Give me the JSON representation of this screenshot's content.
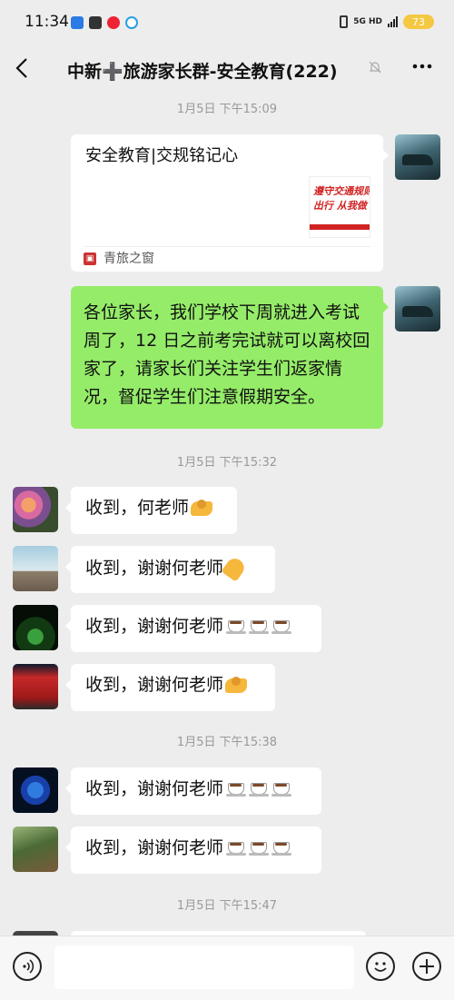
{
  "status_bar": {
    "time": "11:34",
    "network": "5G HD",
    "battery": "73",
    "colors": {
      "battery": "#f4c842"
    }
  },
  "nav": {
    "back_icon": "chevron-left-icon",
    "title": "中新➕旅游家长群-安全教育(222)",
    "mute_icon": "bell-off-icon",
    "more_icon": "more-dots-icon"
  },
  "timestamps": [
    "1月5日 下午15:09",
    "1月5日 下午15:32",
    "1月5日 下午15:38",
    "1月5日 下午15:47"
  ],
  "link_card": {
    "title": "安全教育|交规铭记心",
    "source": "青旅之窗",
    "thumb": {
      "line1": "遵守交通规则",
      "line2": "出行 从我做"
    }
  },
  "self_message": "各位家长，我们学校下周就进入考试周了，12 日之前考完试就可以离校回家了，请家长们关注学生们返家情况，督促学生们注意假期安全。",
  "replies": [
    {
      "text": "收到，何老师",
      "emoji": [
        "handshake"
      ]
    },
    {
      "text": "收到，谢谢何老师",
      "emoji": [
        "clap"
      ]
    },
    {
      "text": "收到，谢谢何老师",
      "emoji": [
        "coffee",
        "coffee",
        "coffee"
      ]
    },
    {
      "text": "收到，谢谢何老师",
      "emoji": [
        "handshake"
      ]
    },
    {
      "text": "收到，谢谢何老师",
      "emoji": [
        "coffee",
        "coffee",
        "coffee"
      ]
    },
    {
      "text": "收到，谢谢何老师",
      "emoji": [
        "coffee",
        "coffee",
        "coffee"
      ]
    }
  ],
  "input_bar": {
    "voice_icon": "voice-icon",
    "emoji_icon": "emoji-icon",
    "plus_icon": "plus-icon"
  },
  "colors": {
    "self_bubble": "#95ec69",
    "other_bubble": "#ffffff",
    "background": "#ededed"
  }
}
